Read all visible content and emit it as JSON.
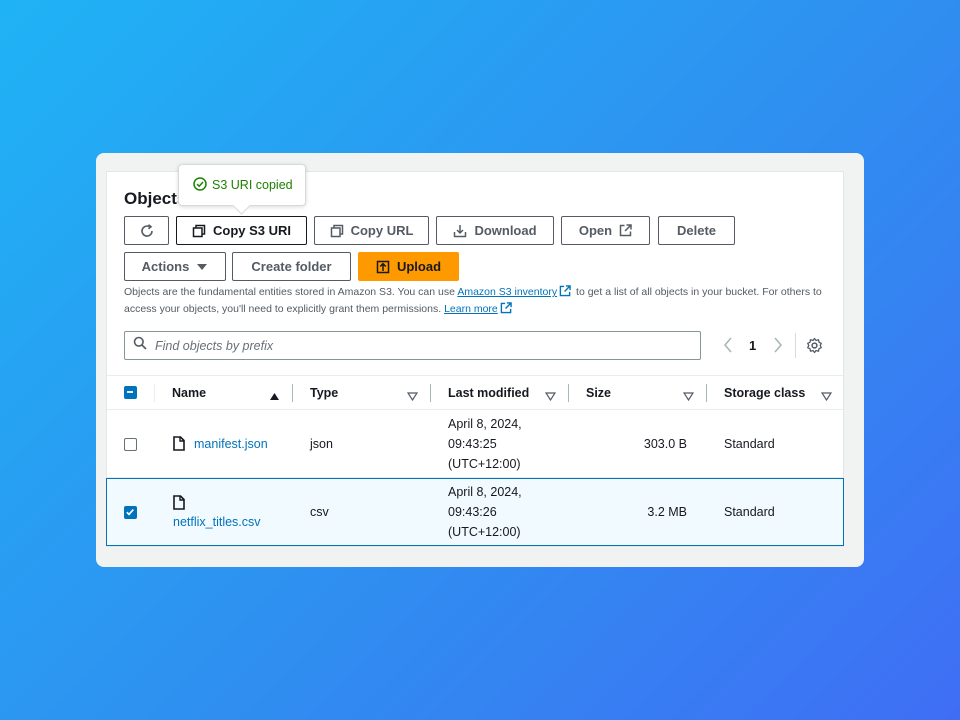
{
  "panel": {
    "title": "Objects",
    "tooltip_text": "S3 URI copied",
    "toolbar": {
      "copy_s3_uri": "Copy S3 URI",
      "copy_url": "Copy URL",
      "download": "Download",
      "open": "Open",
      "delete": "Delete",
      "actions": "Actions",
      "create_folder": "Create folder",
      "upload": "Upload"
    },
    "info": {
      "text1": "Objects are the fundamental entities stored in Amazon S3. You can use",
      "inventory_link": "Amazon S3 inventory",
      "text2": "to get a list of all objects in your bucket. For others to access your objects, you'll need to explicitly grant them permissions.",
      "learn_more": "Learn more"
    },
    "search": {
      "placeholder": "Find objects by prefix"
    },
    "pagination": {
      "current_page": "1"
    }
  },
  "table": {
    "columns": [
      "Name",
      "Type",
      "Last modified",
      "Size",
      "Storage class"
    ],
    "rows": [
      {
        "selected": false,
        "name": "manifest.json",
        "type": "json",
        "last_modified": [
          "April 8, 2024,",
          "09:43:25",
          "(UTC+12:00)"
        ],
        "size": "303.0 B",
        "storage_class": "Standard"
      },
      {
        "selected": true,
        "name": "netflix_titles.csv",
        "type": "csv",
        "last_modified": [
          "April 8, 2024,",
          "09:43:26",
          "(UTC+12:00)"
        ],
        "size": "3.2 MB",
        "storage_class": "Standard"
      }
    ]
  },
  "colors": {
    "primary": "#ff9900",
    "link": "#0073bb",
    "success": "#1d8102",
    "selected_row_bg": "#f1faff"
  },
  "icons": [
    "refresh-icon",
    "copy-icon",
    "download-icon",
    "external-link-icon",
    "caret-down-icon",
    "upload-icon",
    "search-icon",
    "chevron-left-icon",
    "chevron-right-icon",
    "settings-icon",
    "sort-ascending-icon",
    "sort-icon",
    "file-icon",
    "check-circle-icon"
  ]
}
